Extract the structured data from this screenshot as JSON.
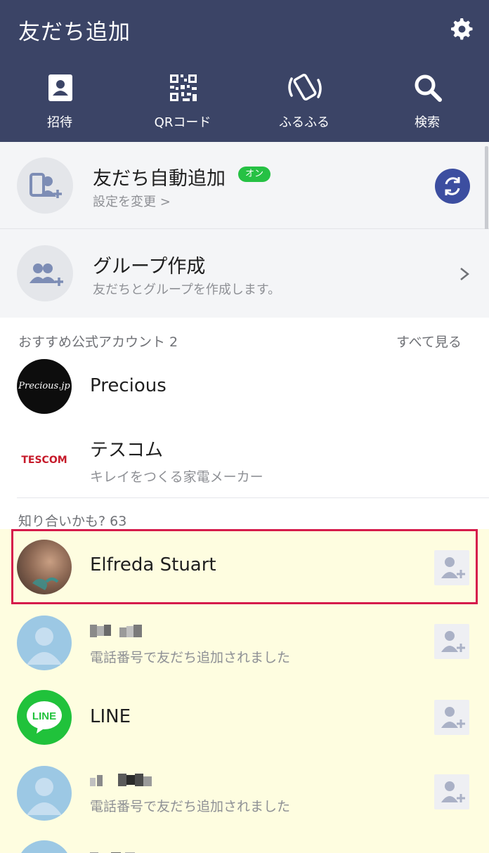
{
  "header": {
    "title": "友だち追加",
    "nav": [
      {
        "label": "招待",
        "icon": "contact-book-icon"
      },
      {
        "label": "QRコード",
        "icon": "qr-code-icon"
      },
      {
        "label": "ふるふる",
        "icon": "shake-phone-icon"
      },
      {
        "label": "検索",
        "icon": "search-icon"
      }
    ],
    "settings_icon": "gear-icon"
  },
  "auto_add": {
    "title": "友だち自動追加",
    "badge": "オン",
    "subtitle": "設定を変更 >",
    "icon": "phone-person-add-icon",
    "action_icon": "sync-icon"
  },
  "group": {
    "title": "グループ作成",
    "subtitle": "友だちとグループを作成します。",
    "icon": "group-add-icon"
  },
  "recommended": {
    "heading": "おすすめ公式アカウント 2",
    "see_all": "すべて見る",
    "items": [
      {
        "name": "Precious",
        "avatar_text": "Precious.jp"
      },
      {
        "name": "テスコム",
        "subtitle": "キレイをつくる家電メーカー",
        "logo_text": "TESCOM"
      }
    ]
  },
  "suggested": {
    "heading": "知り合いかも? 63",
    "items": [
      {
        "name": "Elfreda Stuart"
      },
      {
        "name": "",
        "subtitle": "電話番号で友だち追加されました"
      },
      {
        "name": "LINE",
        "avatar_text": "LINE"
      },
      {
        "name": "",
        "subtitle": "電話番号で友だち追加されました"
      }
    ]
  },
  "colors": {
    "header_bg": "#3b4466",
    "badge_green": "#26c144",
    "sync_blue": "#3c4ea0",
    "highlight_red": "#d61b4b",
    "suggest_bg": "#fefde0",
    "line_green": "#20c23b"
  }
}
